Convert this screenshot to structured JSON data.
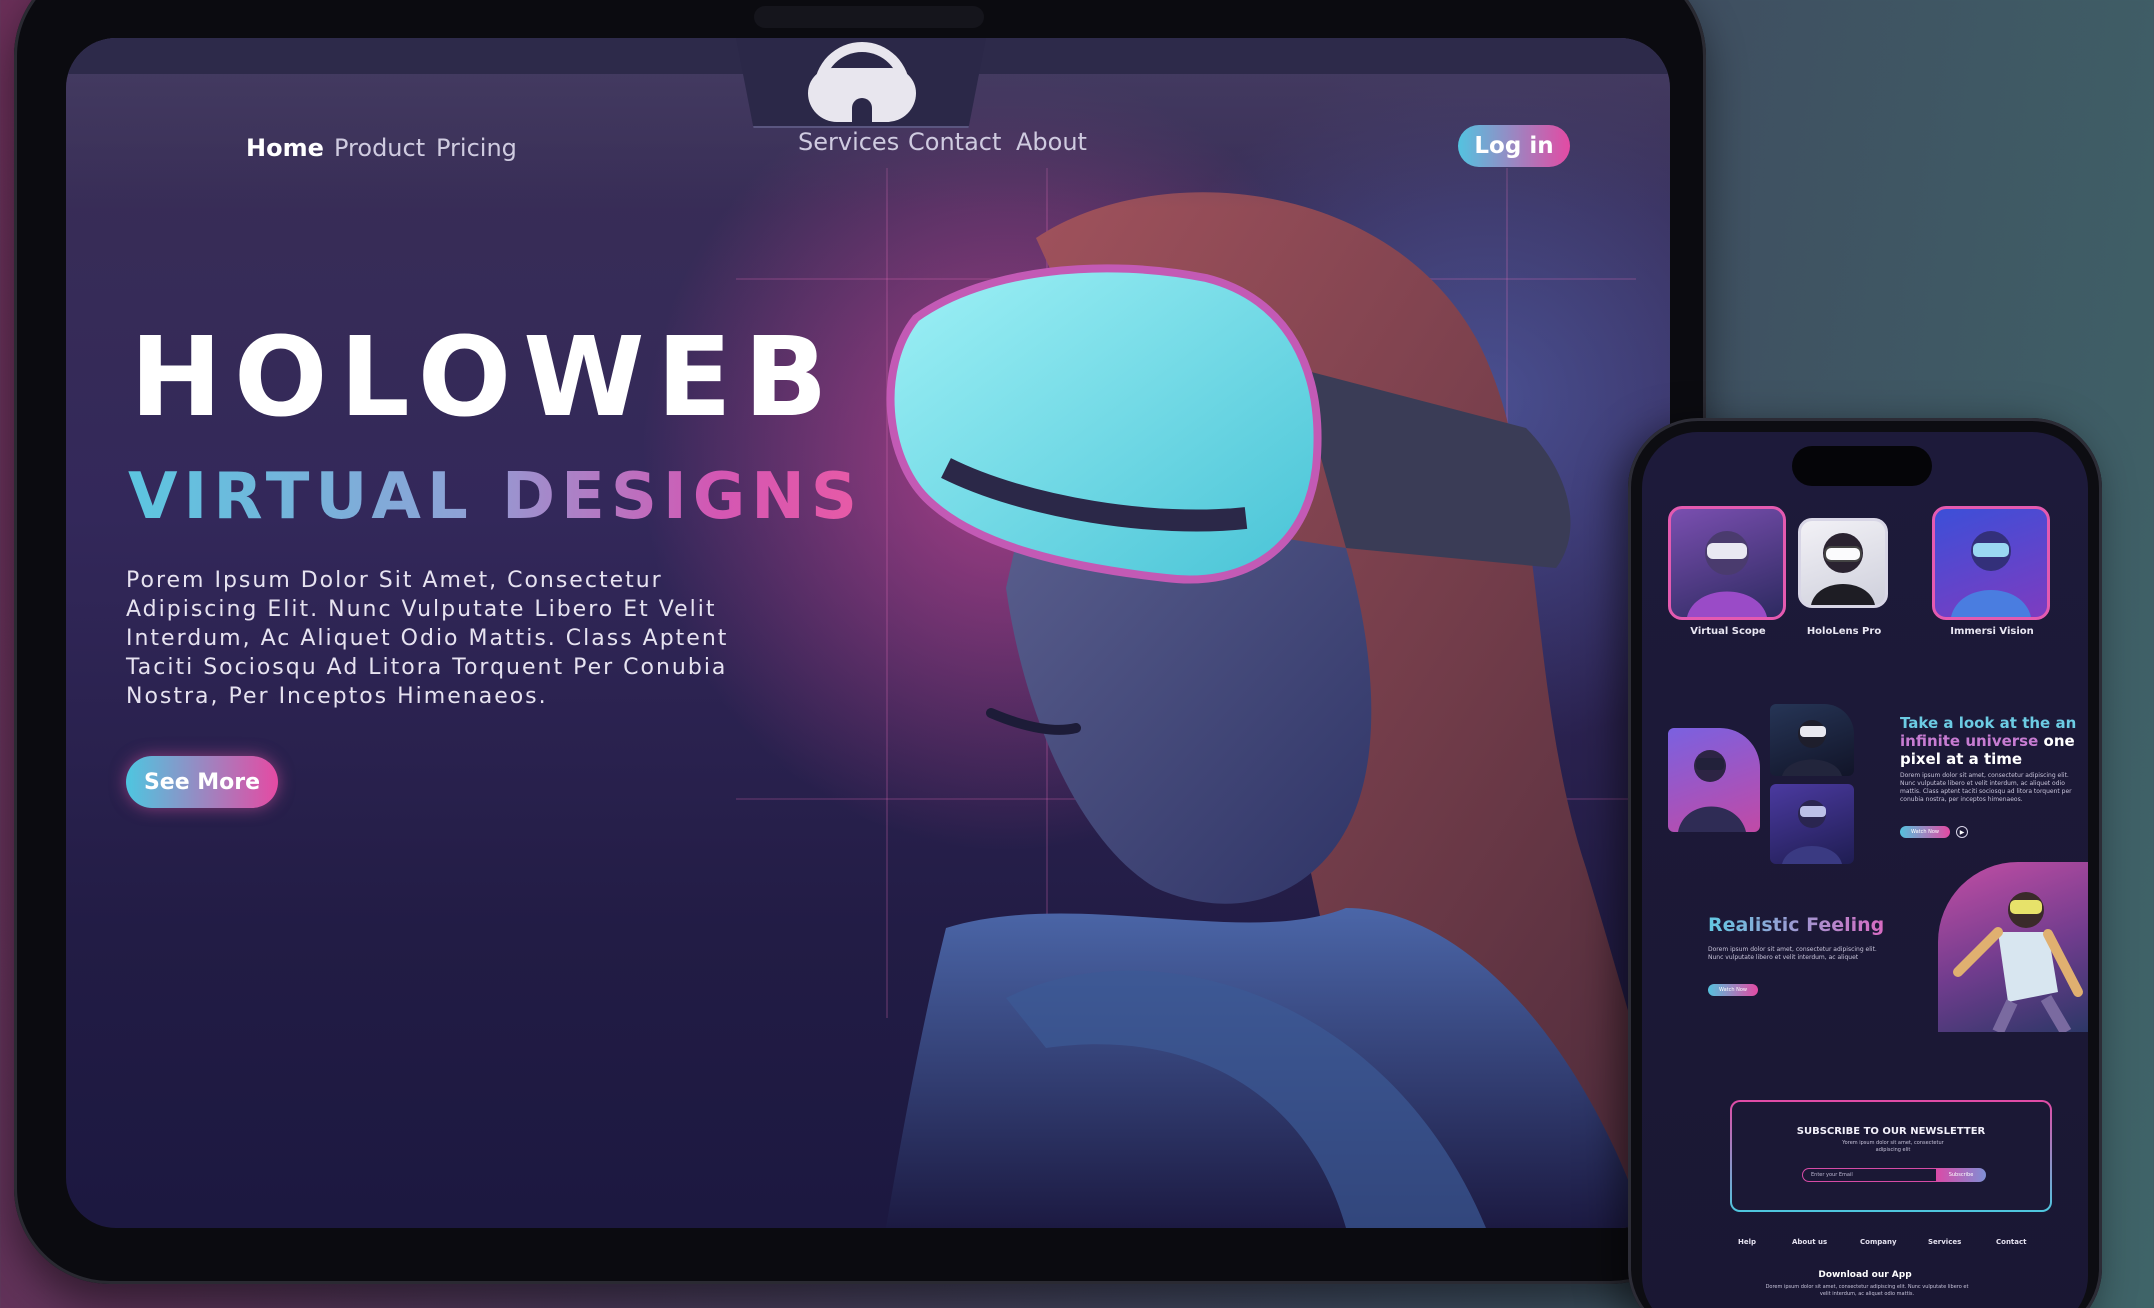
{
  "tablet": {
    "nav": {
      "left_links": [
        "Home",
        "Product",
        "Pricing"
      ],
      "right_links": [
        "Services",
        "Contact",
        "About"
      ],
      "login_label": "Log in",
      "active_link": "Home"
    },
    "hero": {
      "title": "HOLOWEB",
      "subtitle": "VIRTUAL DESIGNS",
      "body": "Porem Ipsum Dolor Sit Amet, Consectetur Adipiscing Elit. Nunc Vulputate Libero Et Velit Interdum, Ac Aliquet Odio Mattis. Class Aptent Taciti Sociosqu Ad Litora Torquent Per Conubia Nostra, Per Inceptos Himenaeos.",
      "cta_label": "See More"
    }
  },
  "phone": {
    "products": [
      "Virtual Scope",
      "HoloLens Pro",
      "Immersi Vision"
    ],
    "feature": {
      "heading_part1": "Take a look at the an",
      "heading_part2": "infinite universe",
      "heading_part3": "one pixel at a time",
      "body": "Dorem ipsum dolor sit amet, consectetur adipiscing elit. Nunc vulputate libero et velit interdum, ac aliquet odio mattis. Class aptent taciti sociosqu ad litora torquent per conubia nostra, per inceptos himenaeos.",
      "button_label": "Watch Now"
    },
    "realistic": {
      "title": "Realistic Feeling",
      "body": "Dorem ipsum dolor sit amet, consectetur adipiscing elit. Nunc vulputate libero et velit interdum, ac aliquet",
      "button_label": "Watch Now"
    },
    "newsletter": {
      "title": "SUBSCRIBE TO OUR NEWSLETTER",
      "subtitle": "Yorem ipsum dolor sit amet, consectetur adipiscing elit",
      "input_placeholder": "Enter your Email",
      "button_label": "Subscribe"
    },
    "footer_links": [
      "Help",
      "About us",
      "Company",
      "Services",
      "Contact"
    ],
    "download": {
      "title": "Download our App",
      "body": "Dorem ipsum dolor sit amet, consectetur adipiscing elit. Nunc vulputate libero et velit interdum, ac aliquet odio mattis."
    }
  },
  "colors": {
    "accent_cyan": "#53c3e0",
    "accent_pink": "#e34aa3",
    "screen_dark": "#1d1a3a"
  }
}
